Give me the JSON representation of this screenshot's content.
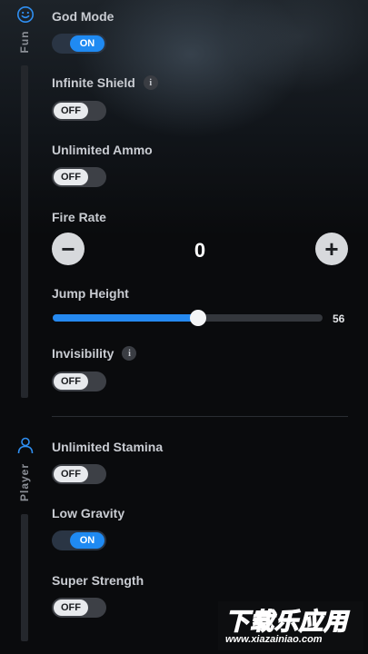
{
  "sidebar": {
    "sections": [
      {
        "label": "Fun",
        "icon": "smiley-icon"
      },
      {
        "label": "Player",
        "icon": "person-icon"
      }
    ]
  },
  "accent_color": "#1f8af2",
  "fun": {
    "god_mode": {
      "label": "God Mode",
      "state": "ON"
    },
    "infinite_shield": {
      "label": "Infinite Shield",
      "info": "i",
      "state": "OFF"
    },
    "unlimited_ammo": {
      "label": "Unlimited Ammo",
      "state": "OFF"
    },
    "fire_rate": {
      "label": "Fire Rate",
      "value": "0",
      "minus": "−",
      "plus": "+"
    },
    "jump_height": {
      "label": "Jump Height",
      "value": "56",
      "fraction": 0.54
    },
    "invisibility": {
      "label": "Invisibility",
      "info": "i",
      "state": "OFF"
    }
  },
  "player": {
    "unlimited_stamina": {
      "label": "Unlimited Stamina",
      "state": "OFF"
    },
    "low_gravity": {
      "label": "Low Gravity",
      "state": "ON"
    },
    "super_strength": {
      "label": "Super Strength",
      "state": "OFF"
    }
  },
  "watermark": {
    "cn": "下载乐应用",
    "url": "www.xiazainiao.com"
  }
}
